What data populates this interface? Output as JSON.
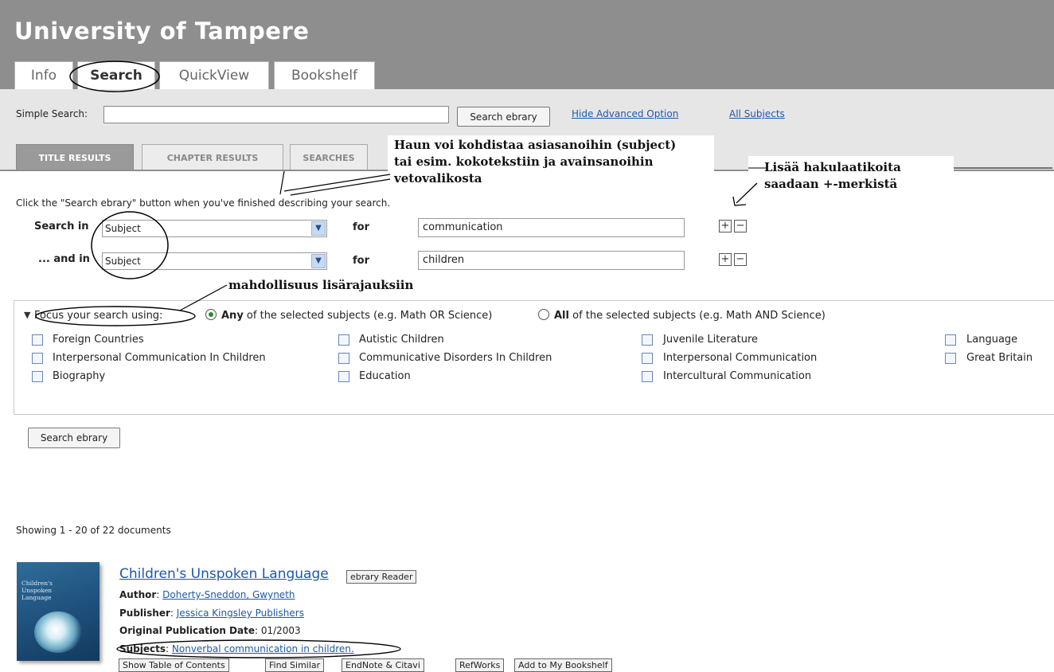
{
  "header": {
    "title": "University of Tampere"
  },
  "main_tabs": [
    {
      "label": "Info"
    },
    {
      "label": "Search",
      "active": true
    },
    {
      "label": "QuickView"
    },
    {
      "label": "Bookshelf"
    }
  ],
  "simple_search": {
    "label": "Simple Search:",
    "value": "",
    "button_label": "Search ebrary",
    "hide_advanced_link": "Hide Advanced Option",
    "all_subjects_link": "All Subjects"
  },
  "result_tabs": [
    {
      "label": "TITLE RESULTS",
      "active": true
    },
    {
      "label": "CHAPTER RESULTS"
    },
    {
      "label": "SEARCHES"
    }
  ],
  "instructions": "Click the \"Search ebrary\" button when you've finished describing your search.",
  "search_rows": [
    {
      "label": "Search in",
      "field": "Subject",
      "for_label": "for",
      "value": "communication"
    },
    {
      "label": "... and in",
      "field": "Subject",
      "for_label": "for",
      "value": "children"
    }
  ],
  "focus": {
    "label": "Focus your search using:",
    "any_bold": "Any",
    "any_rest": " of the selected subjects (e.g. Math OR Science)",
    "all_bold": "All",
    "all_rest": " of the selected subjects (e.g. Math AND Science)",
    "selected": "any",
    "subjects": [
      "Foreign Countries",
      "Autistic Children",
      "Juvenile Literature",
      "Language",
      "Interpersonal Communication In Children",
      "Communicative Disorders In Children",
      "Interpersonal Communication",
      "Great Britain",
      "Biography",
      "Education",
      "Intercultural Communication"
    ]
  },
  "search_button_label": "Search ebrary",
  "results_count_text": "Showing 1 - 20 of 22 documents",
  "result": {
    "cover_text": "Children's Unspoken Language",
    "title": "Children's Unspoken Language",
    "reader_button": "ebrary Reader",
    "author_label": "Author",
    "author": "Doherty-Sneddon, Gwyneth",
    "publisher_label": "Publisher",
    "publisher": "Jessica Kingsley Publishers",
    "pubdate_label": "Original Publication Date",
    "pubdate": "01/2003",
    "subjects_label": "Subjects",
    "subjects": "Nonverbal communication in children.",
    "actions": [
      "Show Table of Contents",
      "Find Similar",
      "EndNote & Citavi",
      "RefWorks",
      "Add to My Bookshelf"
    ]
  },
  "annotations": {
    "subject_note_lines": [
      "Haun voi kohdistaa asiasanoihin (subject)",
      "tai esim. kokotekstiin ja avainsanoihin",
      "vetovalikosta"
    ],
    "plus_note_lines": [
      "Lisää hakulaatikoita",
      "saadaan +-merkistä"
    ],
    "focus_note": "mahdollisuus lisärajauksiin"
  },
  "colors": {
    "header_bg": "#8e8e8e",
    "search_bar_bg": "#e6e6e6",
    "link": "#1f58a8",
    "active_tab": "#9a9a9a"
  }
}
